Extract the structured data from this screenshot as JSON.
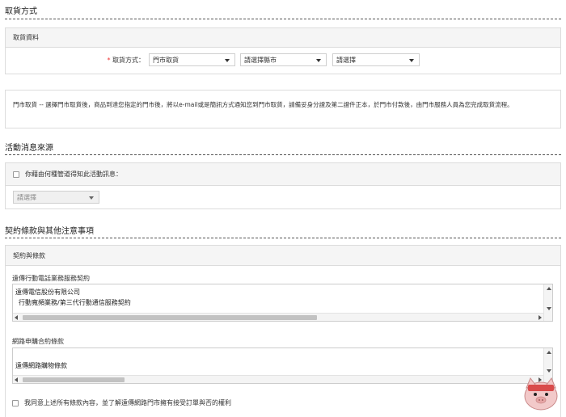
{
  "pickup": {
    "title": "取貨方式",
    "panel_title": "取貨資料",
    "required_mark": "*",
    "field_label": "取貨方式：",
    "method_select": "門市取貨",
    "county_select": "請選擇縣市",
    "store_select": "請選擇",
    "notice": "門市取貨 -- 選擇門市取貨後，商品到達您指定的門市後，將以e-mail或是簡訊方式通知您到門市取貨，請備妥身分證及第二證件正本，於門市付款後，由門市服務人員為您完成取貨流程。"
  },
  "activity": {
    "title": "活動消息來源",
    "question": "你藉由何種管道得知此活動訊息：",
    "source_select": "請選擇"
  },
  "terms": {
    "title": "契約條款與其他注意事項",
    "panel_title": "契約與條款",
    "mobile_contract_label": "遠傳行動電話業務服務契約",
    "mobile_contract_lines": [
      "遠傳電信股份有限公司",
      "行動寬頻業務/第三代行動通信服務契約"
    ],
    "online_terms_label": "網路申購合約條款",
    "online_terms_lines": [
      "遠傳網路購物條款"
    ],
    "agree_text": "我同意上述所有條款內容，並了解遠傳網路門市擁有接受訂單與否的權利"
  }
}
